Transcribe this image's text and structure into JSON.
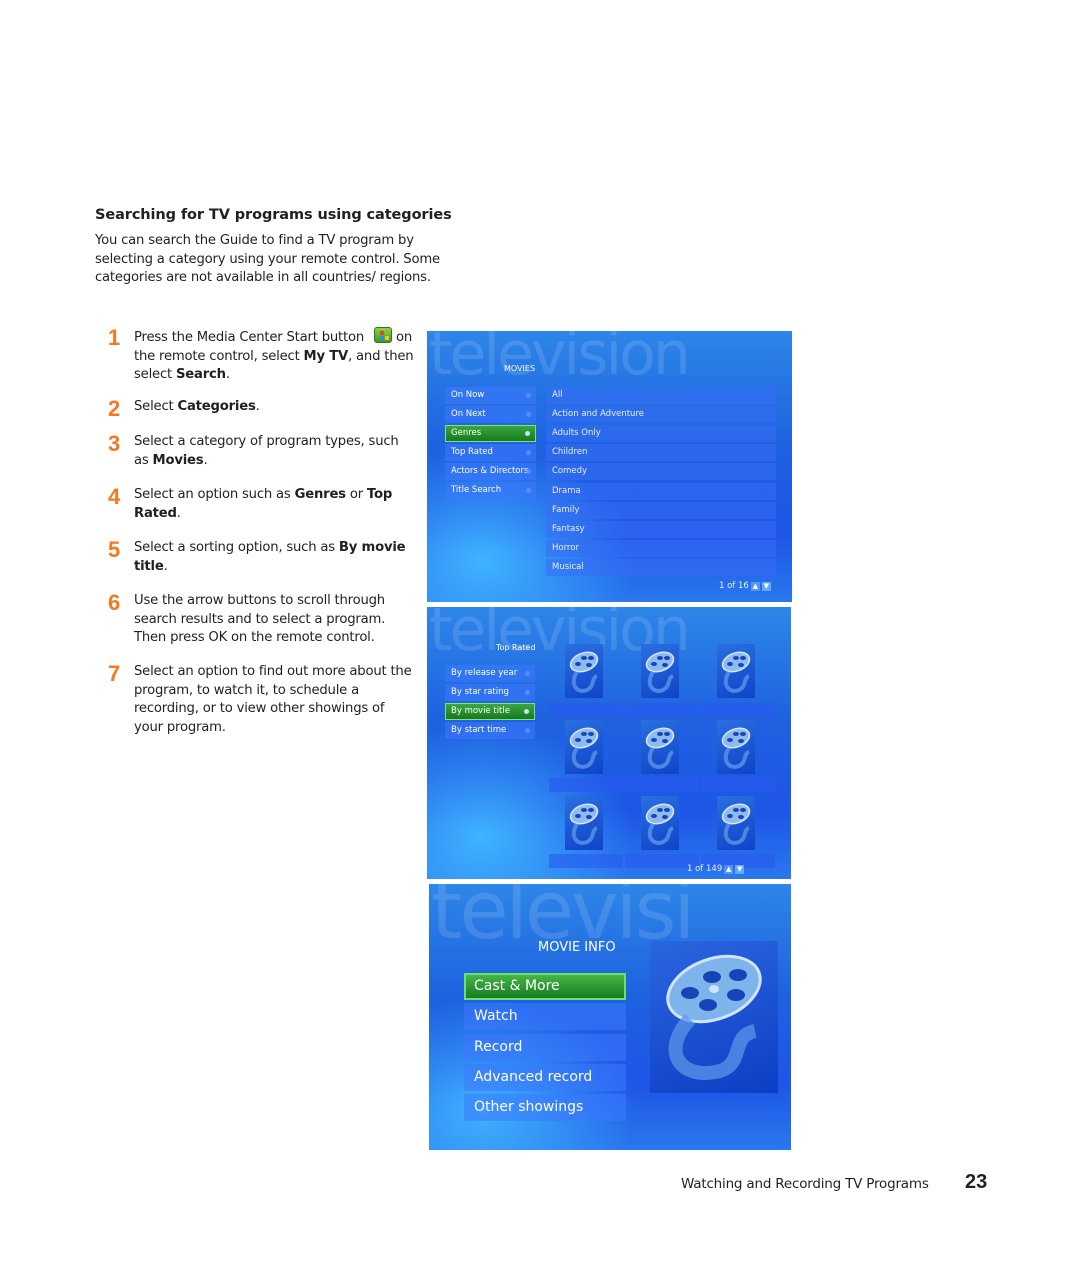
{
  "section": {
    "title": "Searching for TV programs using categories",
    "intro": "You can search the Guide to find a TV program by selecting a category using your remote control. Some categories are not available in all countries/ regions."
  },
  "steps": [
    {
      "num": "1",
      "parts": [
        "Press the Media Center Start button ",
        "[start-icon]",
        " on the remote control, select ",
        "**My TV",
        ", and then select ",
        "**Search",
        "."
      ]
    },
    {
      "num": "2",
      "parts": [
        "Select ",
        "**Categories",
        "."
      ]
    },
    {
      "num": "3",
      "parts": [
        "Select a category of program types, such as ",
        "**Movies",
        "."
      ]
    },
    {
      "num": "4",
      "parts": [
        "Select an option such as ",
        "**Genres",
        " or ",
        "**Top Rated",
        "."
      ]
    },
    {
      "num": "5",
      "parts": [
        "Select a sorting option, such as ",
        "**By movie title",
        "."
      ]
    },
    {
      "num": "6",
      "parts": [
        "Use the arrow buttons to scroll through search results and to select a program. Then press OK on the remote control."
      ]
    },
    {
      "num": "7",
      "parts": [
        "Select an option to find out more about the program, to watch it, to schedule a recording, or to view other showings of your program."
      ]
    }
  ],
  "screen1": {
    "watermark": "television",
    "title": "MOVIES",
    "menu": [
      {
        "label": "On Now",
        "selected": false
      },
      {
        "label": "On Next",
        "selected": false
      },
      {
        "label": "Genres",
        "selected": true
      },
      {
        "label": "Top Rated",
        "selected": false
      },
      {
        "label": "Actors & Directors",
        "selected": false
      },
      {
        "label": "Title Search",
        "selected": false
      }
    ],
    "genres": [
      "All",
      "Action and Adventure",
      "Adults Only",
      "Children",
      "Comedy",
      "Drama",
      "Family",
      "Fantasy",
      "Horror",
      "Musical"
    ],
    "pager": "1 of 16"
  },
  "screen2": {
    "watermark": "television",
    "title": "Top Rated",
    "menu": [
      {
        "label": "By release year",
        "selected": false
      },
      {
        "label": "By star rating",
        "selected": false
      },
      {
        "label": "By movie title",
        "selected": true
      },
      {
        "label": "By start time",
        "selected": false
      }
    ],
    "poster_icon": "film-reel-icon",
    "pager": "1 of 149"
  },
  "screen3": {
    "watermark": "televisi",
    "title": "MOVIE INFO",
    "menu": [
      {
        "label": "Cast & More",
        "selected": true
      },
      {
        "label": "Watch",
        "selected": false
      },
      {
        "label": "Record",
        "selected": false
      },
      {
        "label": "Advanced record",
        "selected": false
      },
      {
        "label": "Other showings",
        "selected": false
      }
    ],
    "poster_icon": "film-reel-icon"
  },
  "footer": {
    "chapter": "Watching and Recording TV Programs",
    "page": "23"
  },
  "colors": {
    "step_number": "#f47920",
    "selected_item": "#2a9a2e",
    "screen_blue": "#1f5fe4"
  }
}
